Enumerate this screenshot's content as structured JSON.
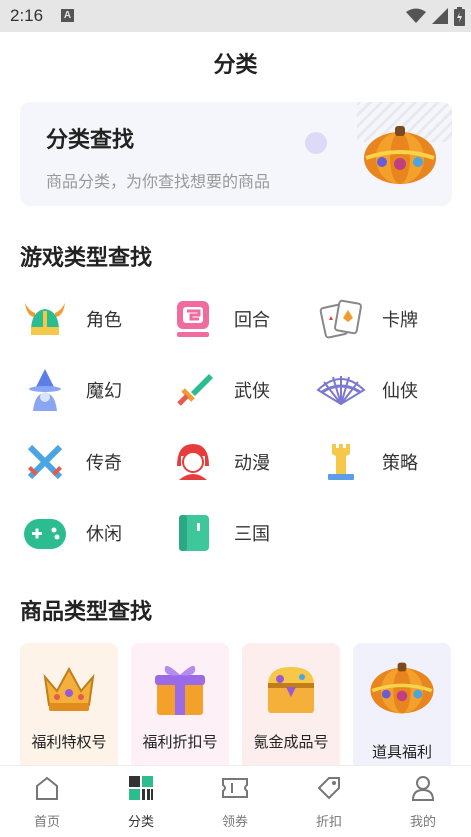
{
  "status_bar": {
    "time": "2:16",
    "notification_letter": "A"
  },
  "header": {
    "title": "分类"
  },
  "banner": {
    "title": "分类查找",
    "subtitle": "商品分类，为你查找想要的商品"
  },
  "game_section": {
    "title": "游戏类型查找",
    "items": [
      {
        "label": "角色",
        "icon": "viking-helmet-icon"
      },
      {
        "label": "回合",
        "icon": "turn-icon"
      },
      {
        "label": "卡牌",
        "icon": "cards-icon"
      },
      {
        "label": "魔幻",
        "icon": "wizard-icon"
      },
      {
        "label": "武侠",
        "icon": "sword-icon"
      },
      {
        "label": "仙侠",
        "icon": "fan-icon"
      },
      {
        "label": "传奇",
        "icon": "crossed-swords-icon"
      },
      {
        "label": "动漫",
        "icon": "anime-girl-icon"
      },
      {
        "label": "策略",
        "icon": "castle-tower-icon"
      },
      {
        "label": "休闲",
        "icon": "gamepad-icon"
      },
      {
        "label": "三国",
        "icon": "book-icon"
      }
    ]
  },
  "goods_section": {
    "title": "商品类型查找",
    "cards": [
      {
        "label": "福利特权号",
        "bg": "#fdf3e8",
        "icon": "crown-icon"
      },
      {
        "label": "福利折扣号",
        "bg": "#fdf0f6",
        "icon": "gift-box-icon"
      },
      {
        "label": "氪金成品号",
        "bg": "#fdeeee",
        "icon": "treasure-chest-icon"
      },
      {
        "label": "道具福利",
        "bg": "#f1f1fb",
        "icon": "pumpkin-icon"
      }
    ]
  },
  "tabbar": {
    "tabs": [
      {
        "label": "首页",
        "icon": "home-icon"
      },
      {
        "label": "分类",
        "icon": "category-icon"
      },
      {
        "label": "领券",
        "icon": "ticket-icon"
      },
      {
        "label": "折扣",
        "icon": "tag-icon"
      },
      {
        "label": "我的",
        "icon": "user-icon"
      }
    ],
    "active_index": 1
  },
  "colors": {
    "accent": "#2bbd8f",
    "text": "#222222",
    "muted": "#999999"
  }
}
